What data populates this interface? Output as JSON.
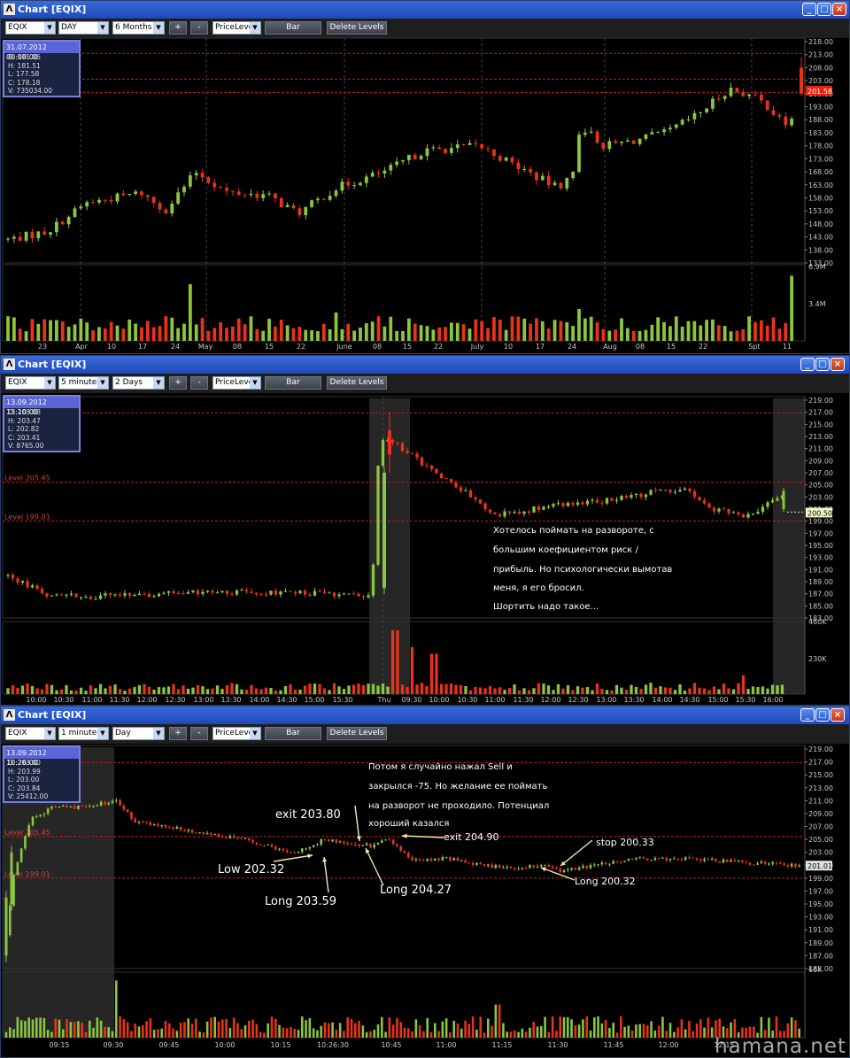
{
  "windows": [
    {
      "title": "Chart [EQIX]",
      "symbol": "EQIX",
      "period": "DAY",
      "range": "6 Months",
      "price_level": "PriceLeve",
      "plus": "+",
      "minus": "-",
      "bar": "Bar",
      "delete_levels": "Delete Levels",
      "info": {
        "date": "31.07.2012 00:00:00",
        "o": "O: 181.06",
        "h": "H: 181.51",
        "l": "L: 177.58",
        "c": "C: 178.18",
        "v": "V: 735034.00"
      },
      "price_axis": [
        "218.00",
        "213.00",
        "208.00",
        "203.00",
        "198.00",
        "193.00",
        "188.00",
        "183.00",
        "178.00",
        "173.00",
        "168.00",
        "163.00",
        "158.00",
        "153.00",
        "148.00",
        "143.00",
        "138.00",
        "133.00"
      ],
      "current_price": "201.58",
      "volume_axis": [
        "6.9M",
        "3.4M"
      ],
      "time_axis": [
        "23",
        "Apr",
        "10",
        "17",
        "24",
        "May",
        "08",
        "15",
        "22",
        "June",
        "08",
        "15",
        "22",
        "July",
        "10",
        "17",
        "24",
        "Aug",
        "08",
        "15",
        "22",
        "Spt",
        "11"
      ],
      "level_labels": [],
      "annotations": []
    },
    {
      "title": "Chart [EQIX]",
      "symbol": "EQIX",
      "period": "5 minutes",
      "range": "2 Days",
      "price_level": "PriceLeve",
      "plus": "+",
      "minus": "-",
      "bar": "Bar",
      "delete_levels": "Delete Levels",
      "info": {
        "date": "13.09.2012 13:10:00",
        "o": "O: 203.08",
        "h": "H: 203.47",
        "l": "L: 202.82",
        "c": "C: 203.41",
        "v": "V: 8765.00"
      },
      "price_axis": [
        "219.00",
        "217.00",
        "215.00",
        "213.00",
        "211.00",
        "209.00",
        "207.00",
        "205.00",
        "203.00",
        "201.00",
        "199.00",
        "197.00",
        "195.00",
        "193.00",
        "191.00",
        "189.00",
        "187.00",
        "185.00",
        "183.00"
      ],
      "current_price": "200.50",
      "volume_axis": [
        "460K",
        "230K"
      ],
      "time_axis": [
        "10:00",
        "10:30",
        "11:00",
        "11:30",
        "12:00",
        "12:30",
        "13:00",
        "13:30",
        "14:00",
        "14:30",
        "15:00",
        "15:30",
        "Thu",
        "09:30",
        "10:00",
        "10:30",
        "11:00",
        "11:30",
        "12:00",
        "12:30",
        "13:00",
        "13:30",
        "14:00",
        "14:30",
        "15:00",
        "15:30",
        "16:00"
      ],
      "level_labels": [
        "Level 205.45",
        "Level 199.01"
      ],
      "annotations": [
        "Хотелось поймать на развороте, с",
        "большим коефициентом риск /",
        "прибыль. Но психологически вымотав",
        "меня, я его бросил.",
        "Шортить надо такое..."
      ]
    },
    {
      "title": "Chart [EQIX]",
      "symbol": "EQIX",
      "period": "1 minute",
      "range": "Day",
      "price_level": "PriceLeve",
      "plus": "+",
      "minus": "-",
      "bar": "Bar",
      "delete_levels": "Delete Levels",
      "info": {
        "date": "13.09.2012 10:26:00",
        "o": "O: 203.00",
        "h": "H: 203.99",
        "l": "L: 203.00",
        "c": "C: 203.84",
        "v": "V: 25412.00"
      },
      "price_axis": [
        "219.00",
        "217.00",
        "215.00",
        "213.00",
        "211.00",
        "209.00",
        "207.00",
        "205.00",
        "203.00",
        "201.00",
        "199.00",
        "197.00",
        "195.00",
        "193.00",
        "191.00",
        "189.00",
        "187.00",
        "185.00"
      ],
      "current_price": "201.01",
      "volume_axis": [
        "66K"
      ],
      "time_axis": [
        "09:15",
        "09:30",
        "09:45",
        "10:00",
        "10:15",
        "10:26:30",
        "10:45",
        "11:00",
        "11:15",
        "11:30",
        "11:45",
        "12:00",
        "12:15"
      ],
      "level_labels": [
        "Level 205.45",
        "Level 199.01"
      ],
      "annotations": [
        "Потом я случайно нажал Sell и",
        "закрылся -75. Но желание ее поймать",
        "на разворот не проходило. Потенциал",
        "хороший казался"
      ],
      "trade_labels": {
        "exit1": "exit 203.80",
        "exit2": "exit 204.90",
        "stop": "stop 200.33",
        "low": "Low 202.32",
        "long1": "Long 203.59",
        "long2": "Long 204.27",
        "long3": "Long 200.32"
      }
    }
  ],
  "watermark": "hamana.net",
  "colors": {
    "up": "#8cc63e",
    "down": "#e8331a",
    "level": "#c02020",
    "grid": "#3a3a3a",
    "axis_text": "#c8c8c8",
    "title_bar": "#2456c8"
  }
}
